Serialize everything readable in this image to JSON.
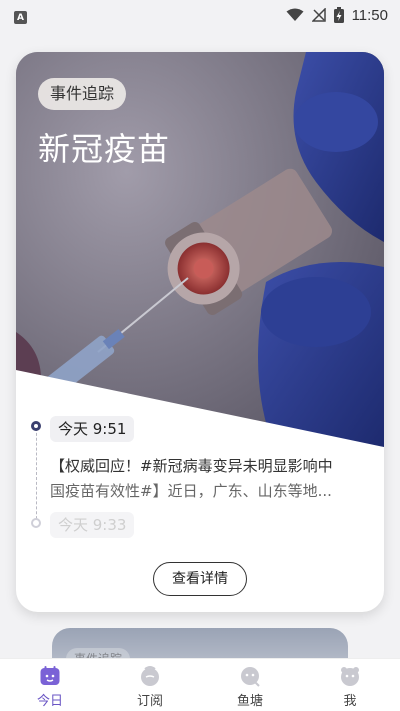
{
  "status_bar": {
    "app_badge": "A",
    "time": "11:50"
  },
  "event_card": {
    "tag": "事件追踪",
    "title": "新冠疫苗",
    "timeline": [
      {
        "time": "今天 9:51",
        "text_line1": "【权威回应！#新冠病毒变异未明显影响中",
        "text_line2": "国疫苗有效性#】近日，广东、山东等地..."
      },
      {
        "time": "今天 9:33"
      }
    ],
    "detail_button": "查看详情"
  },
  "next_card": {
    "tag": "事件追踪"
  },
  "bottom_nav": {
    "items": [
      {
        "label": "今日",
        "icon": "today-icon",
        "active": true
      },
      {
        "label": "订阅",
        "icon": "subscribe-icon",
        "active": false
      },
      {
        "label": "鱼塘",
        "icon": "fishpond-icon",
        "active": false
      },
      {
        "label": "我",
        "icon": "me-icon",
        "active": false
      }
    ],
    "active_color": "#6a55c4"
  }
}
